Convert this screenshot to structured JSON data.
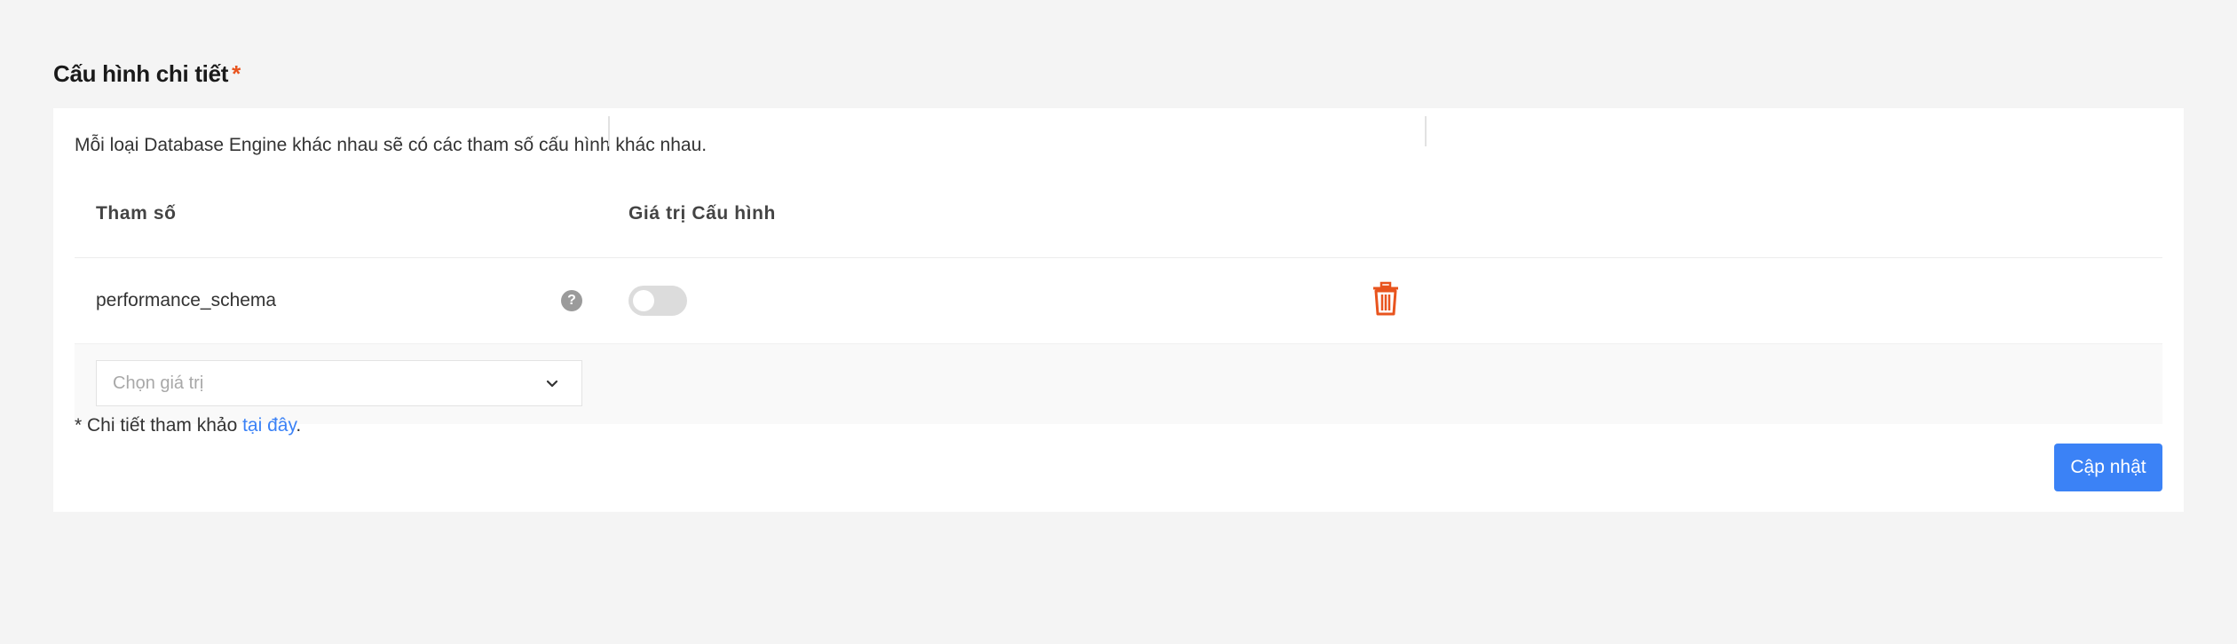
{
  "section": {
    "title": "Cấu hình chi tiết",
    "required_mark": "*"
  },
  "config": {
    "description": "Mỗi loại Database Engine khác nhau sẽ có các tham số cấu hình khác nhau.",
    "columns": {
      "param": "Tham số",
      "value": "Giá trị Cấu hình"
    },
    "rows": [
      {
        "name": "performance_schema",
        "help_icon": "question-circle-icon",
        "help_glyph": "?",
        "value_enabled": false,
        "action_icon": "trash-icon"
      }
    ],
    "add_select": {
      "placeholder": "Chọn giá trị",
      "icon": "chevron-down-icon"
    }
  },
  "note": {
    "prefix": "* Chi tiết tham khảo ",
    "link_text": "tại đây",
    "suffix": "."
  },
  "actions": {
    "update_label": "Cập nhật"
  },
  "colors": {
    "accent": "#3b82f6",
    "danger": "#e8541e",
    "background": "#f4f4f4",
    "card": "#ffffff"
  }
}
